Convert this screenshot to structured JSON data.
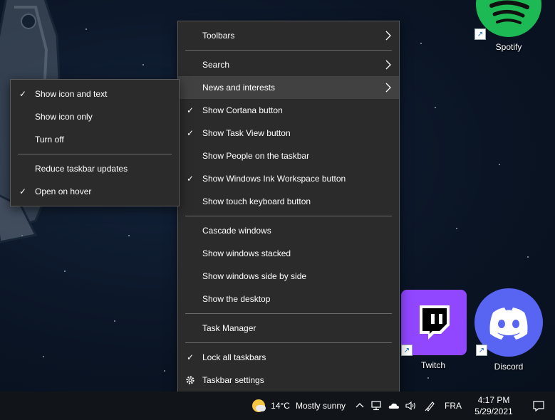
{
  "desktop": {
    "icons": [
      {
        "label": "Spotify",
        "color": "#1db954"
      },
      {
        "label": "Twitch",
        "color": "#9146ff"
      },
      {
        "label": "Discord",
        "color": "#5865f2"
      }
    ]
  },
  "context_menu": {
    "items": [
      {
        "label": "Toolbars",
        "submenu": true
      },
      {
        "label": "Search",
        "submenu": true
      },
      {
        "label": "News and interests",
        "submenu": true,
        "active": true
      },
      {
        "label": "Show Cortana button",
        "checked": true
      },
      {
        "label": "Show Task View button",
        "checked": true
      },
      {
        "label": "Show People on the taskbar"
      },
      {
        "label": "Show Windows Ink Workspace button",
        "checked": true
      },
      {
        "label": "Show touch keyboard button"
      },
      {
        "label": "Cascade windows"
      },
      {
        "label": "Show windows stacked"
      },
      {
        "label": "Show windows side by side"
      },
      {
        "label": "Show the desktop"
      },
      {
        "label": "Task Manager"
      },
      {
        "label": "Lock all taskbars",
        "checked": true
      },
      {
        "label": "Taskbar settings",
        "icon": "gear-icon"
      }
    ]
  },
  "submenu": {
    "items": [
      {
        "label": "Show icon and text",
        "checked": true
      },
      {
        "label": "Show icon only"
      },
      {
        "label": "Turn off"
      },
      {
        "label": "Reduce taskbar updates"
      },
      {
        "label": "Open on hover",
        "checked": true
      }
    ]
  },
  "taskbar": {
    "weather_temp": "14°C",
    "weather_text": "Mostly sunny",
    "language": "FRA",
    "time": "4:17 PM",
    "date": "5/29/2021",
    "icons": [
      "chevron-up-icon",
      "network-icon",
      "onedrive-cloud-icon",
      "volume-icon",
      "pen-icon",
      "notifications-icon"
    ]
  }
}
